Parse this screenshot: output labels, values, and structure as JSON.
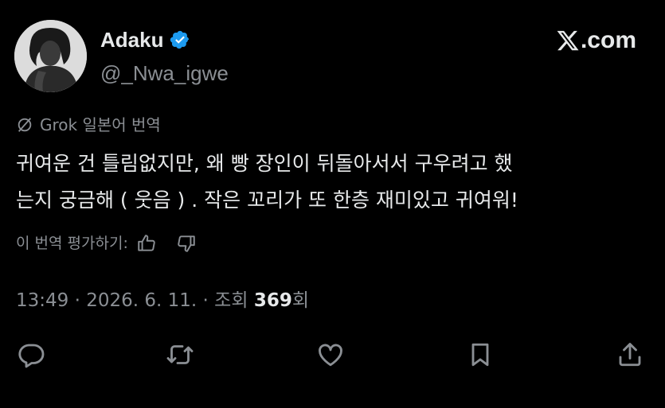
{
  "author": {
    "name": "Adaku",
    "handle": "@_Nwa_igwe",
    "verified": true,
    "verified_color": "#1d9bf0"
  },
  "site_brand": ".com",
  "translation": {
    "label": "Grok 일본어 번역",
    "icon": "slash-circle-icon"
  },
  "tweet": {
    "lines": [
      "귀여운 건 틀림없지만, 왜 빵 장인이 뒤돌아서서 구우려고 했",
      "는지 궁금해 ( 웃음 ) . 작은 꼬리가 또 한층 재미있고 귀여워!"
    ]
  },
  "rating": {
    "label": "이 번역 평가하기:",
    "icons": [
      "thumbs-up-icon",
      "thumbs-down-icon"
    ]
  },
  "meta": {
    "time": "13:49",
    "separator": "·",
    "date": "2026. 6. 11.",
    "views_label": "조회",
    "views_count": "369",
    "views_suffix": "회"
  },
  "actions": [
    "reply-icon",
    "retweet-icon",
    "like-icon",
    "bookmark-icon",
    "share-icon"
  ],
  "colors": {
    "background": "#000000",
    "primary_text": "#e7e9ea",
    "secondary_text": "#8b8f94"
  }
}
